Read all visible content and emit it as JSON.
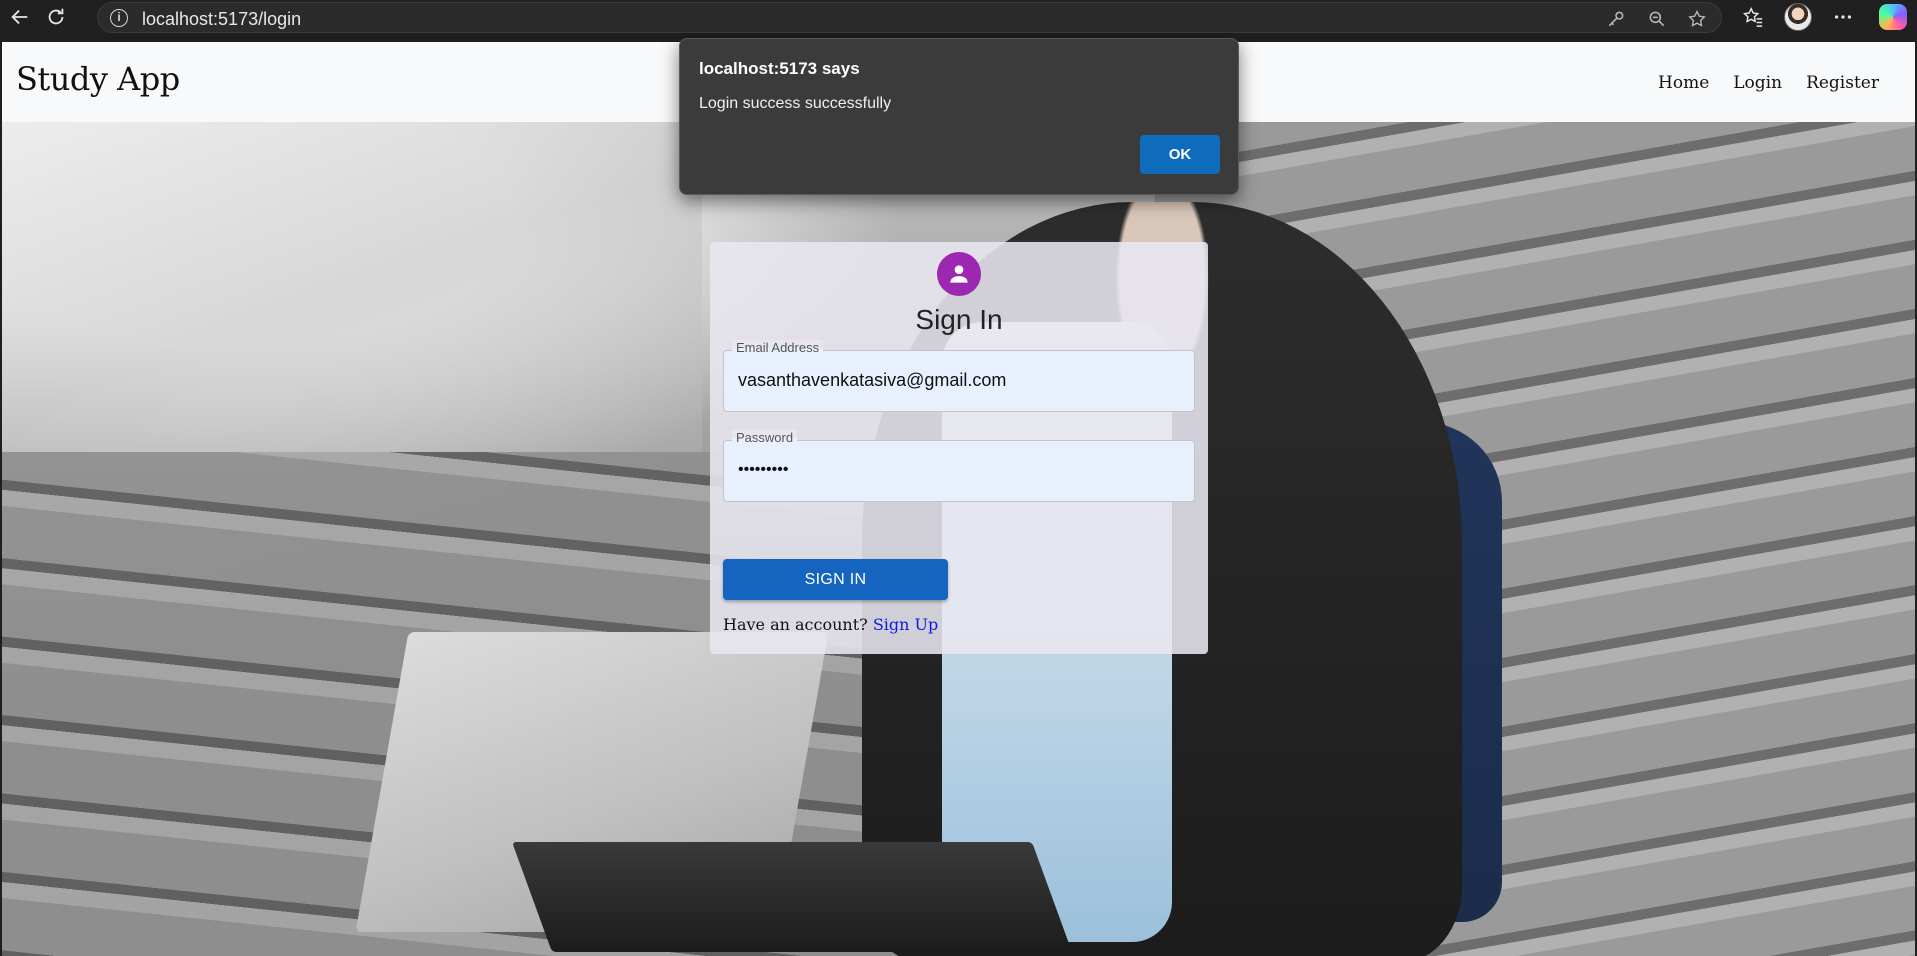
{
  "browser": {
    "url": "localhost:5173/login"
  },
  "navbar": {
    "brand": "Study App",
    "links": [
      "Home",
      "Login",
      "Register"
    ]
  },
  "signin": {
    "title": "Sign In",
    "email": {
      "label": "Email Address",
      "value": "vasanthavenkatasiva@gmail.com"
    },
    "password": {
      "label": "Password",
      "value": "•••••••••"
    },
    "button": "SIGN IN",
    "account_prompt": "Have an account?",
    "signup_link": "Sign Up",
    "avatar_color": "#9c27b0",
    "button_color": "#1565c0"
  },
  "dialog": {
    "title": "localhost:5173 says",
    "message": "Login success successfully",
    "ok_label": "OK",
    "ok_color": "#0f6cbd"
  },
  "icons": [
    "back-icon",
    "reload-icon",
    "info-icon",
    "key-icon",
    "zoom-icon",
    "star-icon",
    "favorites-icon",
    "profile-avatar",
    "more-icon",
    "copilot-icon",
    "person-icon"
  ]
}
